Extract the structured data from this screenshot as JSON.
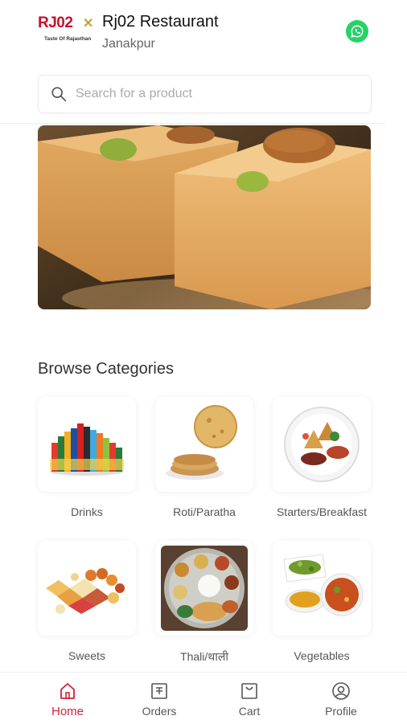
{
  "header": {
    "logo_text": "RJ02",
    "logo_tagline": "Taste Of Rajasthan",
    "restaurant_name": "Rj02 Restaurant",
    "location": "Janakpur"
  },
  "search": {
    "placeholder": "Search for a product"
  },
  "browse": {
    "title": "Browse Categories",
    "categories": [
      {
        "label": "Drinks"
      },
      {
        "label": "Roti/Paratha"
      },
      {
        "label": "Starters/Breakfast"
      },
      {
        "label": "Sweets"
      },
      {
        "label": "Thali/थाली"
      },
      {
        "label": "Vegetables"
      }
    ]
  },
  "nav": {
    "items": [
      {
        "label": "Home",
        "icon": "home-icon",
        "active": true
      },
      {
        "label": "Orders",
        "icon": "orders-icon"
      },
      {
        "label": "Cart",
        "icon": "cart-icon"
      },
      {
        "label": "Profile",
        "icon": "profile-icon"
      }
    ]
  },
  "colors": {
    "brand": "#c8102e",
    "active_nav": "#d6203a",
    "whatsapp": "#25d366"
  }
}
